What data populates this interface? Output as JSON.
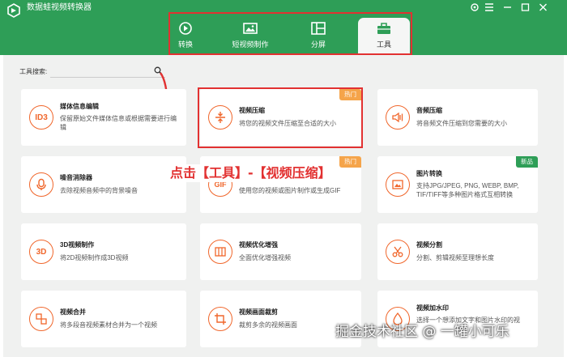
{
  "window": {
    "title": "数据蛙视频转换器"
  },
  "tabs": [
    {
      "label": "转换",
      "icon": "convert-icon"
    },
    {
      "label": "短视频制作",
      "icon": "image-icon"
    },
    {
      "label": "分屏",
      "icon": "split-screen-icon"
    },
    {
      "label": "工具",
      "icon": "toolbox-icon",
      "active": true
    }
  ],
  "search": {
    "label": "工具搜索:",
    "placeholder": ""
  },
  "tools": [
    {
      "title": "媒体信息编辑",
      "desc": "保留原始文件媒体信息或根据需要进行编辑",
      "icon_text": "ID3",
      "icon": "id3-icon"
    },
    {
      "title": "视频压缩",
      "desc": "将您的视频文件压缩至合适的大小",
      "icon": "compress-icon",
      "badge": "热门"
    },
    {
      "title": "音频压缩",
      "desc": "将音频文件压缩到您需要的大小",
      "icon": "audio-compress-icon"
    },
    {
      "title": "噪音消除器",
      "desc": "去除视频音频中的背景噪音",
      "icon": "noise-icon"
    },
    {
      "title": "",
      "desc": "使用您的视频或图片制作或生成GIF",
      "icon_text": "GIF",
      "icon": "gif-icon",
      "badge": "热门"
    },
    {
      "title": "图片转换",
      "desc": "支持JPG/JPEG, PNG, WEBP, BMP, TIF/TIFF等多种图片格式互相转换",
      "icon": "image-convert-icon",
      "badge": "新品"
    },
    {
      "title": "3D视频制作",
      "desc": "将2D视频制作成3D视频",
      "icon_text": "3D",
      "icon": "3d-icon"
    },
    {
      "title": "视频优化增强",
      "desc": "全面优化增强视频",
      "icon": "enhance-icon"
    },
    {
      "title": "视频分割",
      "desc": "分割、剪辑视频至理想长度",
      "icon": "scissors-icon"
    },
    {
      "title": "视频合并",
      "desc": "将多段音视频素材合并为一个视频",
      "icon": "merge-icon"
    },
    {
      "title": "视频画面裁剪",
      "desc": "裁剪多余的视频画面",
      "icon": "crop-icon"
    },
    {
      "title": "视频加水印",
      "desc": "选择一个想添加文字和图片水印的视",
      "icon": "watermark-icon"
    }
  ],
  "annotation": "点击【工具】-【视频压缩】",
  "watermark": "掘金技术社区 @ 一罐小可乐",
  "colors": {
    "brand": "#2e9e57",
    "accent": "#f0662b",
    "highlight": "#e23131",
    "hot_badge": "#f5a44a",
    "new_badge": "#2e9e57"
  }
}
